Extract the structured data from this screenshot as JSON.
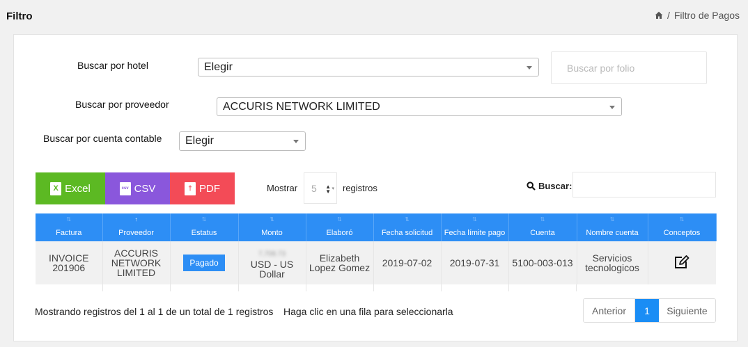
{
  "page": {
    "title": "Filtro"
  },
  "breadcrumb": {
    "current": "Filtro de Pagos"
  },
  "filters": {
    "hotel_label": "Buscar por hotel",
    "hotel_value": "Elegir",
    "folio_placeholder": "Buscar por folio",
    "provider_label": "Buscar por proveedor",
    "provider_value": "ACCURIS NETWORK LIMITED",
    "account_label": "Buscar por cuenta contable",
    "account_value": "Elegir"
  },
  "export": {
    "excel": "Excel",
    "csv": "CSV",
    "pdf": "PDF"
  },
  "table_controls": {
    "show_label": "Mostrar",
    "show_value": "5",
    "records_label": "registros",
    "search_label": "Buscar:"
  },
  "table": {
    "columns": [
      "Factura",
      "Proveedor",
      "Estatus",
      "Monto",
      "Elaboró",
      "Fecha solicitud",
      "Fecha límite pago",
      "Cuenta",
      "Nombre cuenta",
      "Conceptos"
    ],
    "rows": [
      {
        "factura": "INVOICE 201906",
        "proveedor": "ACCURIS NETWORK LIMITED",
        "estatus": "Pagado",
        "monto_amount": "7,708.73",
        "monto_currency": "USD - US Dollar",
        "elaboro": "Elizabeth Lopez Gomez",
        "fecha_solicitud": "2019-07-02",
        "fecha_limite": "2019-07-31",
        "cuenta": "5100-003-013",
        "nombre_cuenta": "Servicios tecnologicos"
      }
    ]
  },
  "footer": {
    "info": "Mostrando registros del 1 al 1 de un total de 1 registros",
    "hint": "Haga clic en una fila para seleccionarla"
  },
  "pagination": {
    "prev": "Anterior",
    "current": "1",
    "next": "Siguiente"
  },
  "colors": {
    "primary": "#2d8ef5",
    "excel": "#5cb923",
    "csv": "#8a57dc",
    "pdf": "#f34b57"
  }
}
